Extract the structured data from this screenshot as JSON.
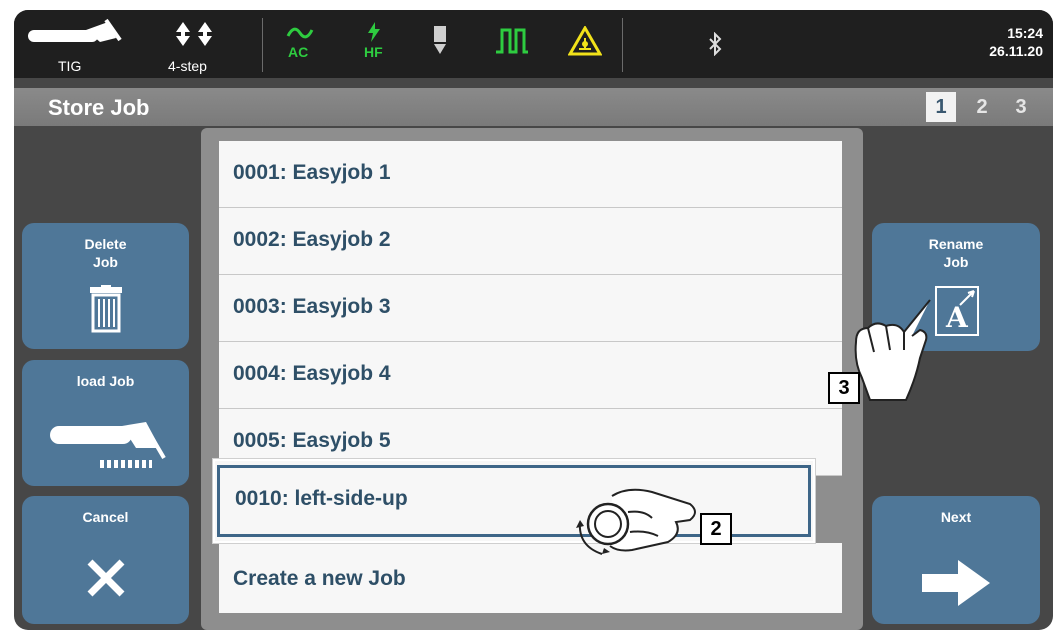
{
  "status_bar": {
    "process": "TIG",
    "mode": "4-step",
    "ac_label": "AC",
    "hf_label": "HF",
    "time": "15:24",
    "date": "26.11.20",
    "accent_green": "#2ecc40",
    "warning_yellow": "#f2e21a"
  },
  "header": {
    "title": "Store Job",
    "pages": [
      "1",
      "2",
      "3"
    ],
    "active_page": "1"
  },
  "left_buttons": {
    "delete_line1": "Delete",
    "delete_line2": "Job",
    "load": "load Job",
    "cancel": "Cancel"
  },
  "right_buttons": {
    "rename_line1": "Rename",
    "rename_line2": "Job",
    "next": "Next",
    "rename_glyph": "A"
  },
  "jobs": [
    "0001: Easyjob 1",
    "0002: Easyjob 2",
    "0003: Easyjob 3",
    "0004: Easyjob 4",
    "0005: Easyjob 5"
  ],
  "selected_job": "0010: left-side-up",
  "create_new": "Create a new Job",
  "callouts": {
    "knob": "2",
    "tap": "3"
  },
  "icons": [
    "tig-torch-icon",
    "trigger-mode-icon",
    "ac-wave-icon",
    "hf-icon",
    "gas-icon",
    "pulse-icon",
    "warning-icon",
    "bluetooth-icon",
    "trash-icon",
    "torch-icon",
    "close-icon",
    "arrow-right-icon",
    "rename-icon",
    "hand-knob-icon",
    "hand-pointer-icon"
  ]
}
